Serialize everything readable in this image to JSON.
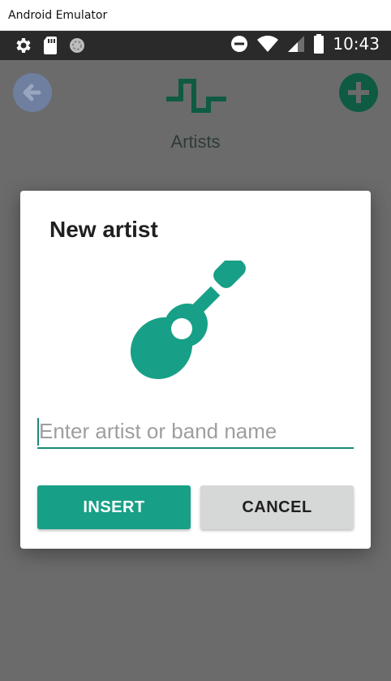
{
  "window": {
    "title": "Android Emulator"
  },
  "status_bar": {
    "time": "10:43",
    "icons_left": [
      "gear-icon",
      "sd-card-icon",
      "sync-icon"
    ],
    "icons_right": [
      "do-not-disturb-icon",
      "wifi-icon",
      "signal-icon",
      "battery-icon"
    ]
  },
  "app_bar": {
    "title": "Artists",
    "back_icon": "arrow-left-icon",
    "logo_icon": "waveform-logo-icon",
    "add_icon": "plus-circle-icon"
  },
  "dialog": {
    "title": "New artist",
    "illustration": "guitar-icon",
    "input": {
      "placeholder": "Enter artist or band name",
      "value": ""
    },
    "insert_label": "INSERT",
    "cancel_label": "CANCEL"
  },
  "colors": {
    "accent": "#17a087",
    "accent_dark": "#0f5a43",
    "dialog_bg": "#ffffff",
    "scrim": "#6b6b6b",
    "cancel_bg": "#d6d7d7"
  }
}
